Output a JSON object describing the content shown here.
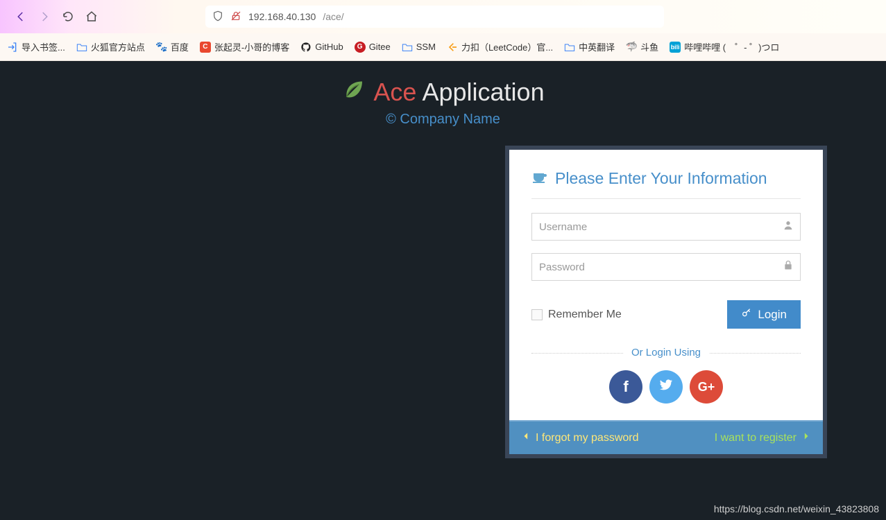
{
  "url": {
    "host": "192.168.40.130",
    "path": "/ace/"
  },
  "bookmarks": [
    {
      "label": "导入书签...",
      "icon": "import"
    },
    {
      "label": "火狐官方站点",
      "icon": "folder"
    },
    {
      "label": "百度",
      "icon": "baidu"
    },
    {
      "label": "张起灵-小哥的博客",
      "icon": "csdn"
    },
    {
      "label": "GitHub",
      "icon": "github"
    },
    {
      "label": "Gitee",
      "icon": "gitee"
    },
    {
      "label": "SSM",
      "icon": "folder"
    },
    {
      "label": "力扣（LeetCode）官...",
      "icon": "leetcode"
    },
    {
      "label": "中英翻译",
      "icon": "folder"
    },
    {
      "label": "斗鱼",
      "icon": "douyu"
    },
    {
      "label": "哔哩哔哩 (　゜- ゜)つロ",
      "icon": "bilibili"
    }
  ],
  "app": {
    "brand_accent": "Ace",
    "brand_rest": " Application",
    "subtitle": "© Company Name"
  },
  "login": {
    "title": "Please Enter Your Information",
    "username_placeholder": "Username",
    "password_placeholder": "Password",
    "remember": "Remember Me",
    "button": "Login",
    "or_divider": "Or Login Using",
    "forgot": "I forgot my password",
    "register": "I want to register"
  },
  "watermark": "https://blog.csdn.net/weixin_43823808"
}
